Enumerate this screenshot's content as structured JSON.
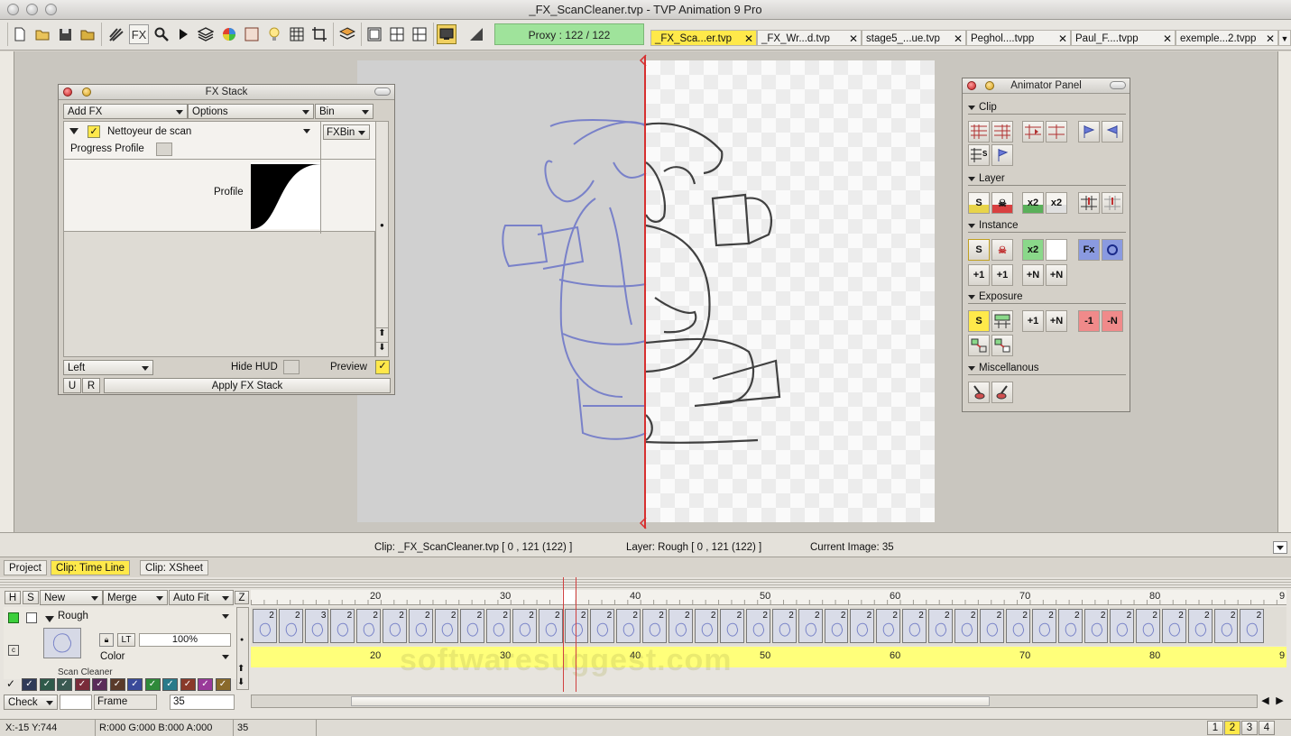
{
  "window": {
    "title": "_FX_ScanCleaner.tvp - TVP Animation 9 Pro"
  },
  "toolbar": {
    "proxy": "Proxy : 122 / 122",
    "fx_label": "FX",
    "doc_tabs": [
      "_FX_Sca...er.tvp",
      "_FX_Wr...d.tvp",
      "stage5_...ue.tvp",
      "Peghol....tvpp",
      "Paul_F....tvpp",
      "exemple...2.tvpp"
    ],
    "close_glyph": "✕",
    "tab_menu": "▼"
  },
  "fx_stack": {
    "title": "FX Stack",
    "add_fx": "Add FX",
    "options": "Options",
    "bin": "Bin",
    "effect_name": "Nettoyeur de scan",
    "fxbin": "FXBin",
    "progress_profile": "Progress Profile",
    "profile": "Profile",
    "left": "Left",
    "hide_hud": "Hide HUD",
    "preview": "Preview",
    "check_glyph": "✓",
    "u": "U",
    "r": "R",
    "apply": "Apply FX Stack"
  },
  "animator_panel": {
    "title": "Animator Panel",
    "sections": {
      "clip": "Clip",
      "layer": "Layer",
      "instance": "Instance",
      "exposure": "Exposure",
      "misc": "Miscellanous"
    },
    "layer_icons": [
      "S",
      "☠",
      "x2",
      "x2"
    ],
    "instance_icons": [
      "S",
      "☠",
      "x2",
      "Fx"
    ],
    "instance_row2": [
      "+1",
      "+1",
      "+N",
      "+N"
    ],
    "exposure_icons": [
      "S",
      "+1",
      "+N",
      "-1",
      "-N"
    ]
  },
  "status": {
    "clip": "Clip: _FX_ScanCleaner.tvp [ 0 , 121  (122) ]",
    "layer": "Layer: Rough [ 0 , 121  (122) ]",
    "current_image": "Current Image: 35"
  },
  "tabs": {
    "project": "Project",
    "timeline": "Clip: Time Line",
    "xsheet": "Clip: XSheet"
  },
  "timeline": {
    "h": "H",
    "s": "S",
    "z": "Z",
    "new": "New",
    "merge": "Merge",
    "auto_fit": "Auto Fit",
    "layer_name": "Rough",
    "lt": "LT",
    "opacity": "100%",
    "color": "Color",
    "next_layer": "Scan Cleaner",
    "check": "Check",
    "frame": "Frame",
    "frame_value": "35",
    "ruler": [
      "20",
      "30",
      "40",
      "50",
      "60",
      "70",
      "80",
      "9"
    ],
    "c_marker": "c",
    "cell_numbers": [
      "2",
      "2",
      "3",
      "2",
      "2",
      "2",
      "2",
      "2",
      "2",
      "2",
      "2",
      "2",
      "2",
      "2",
      "2",
      "2",
      "2",
      "2",
      "2",
      "2",
      "2",
      "2",
      "2",
      "2",
      "2",
      "2",
      "2",
      "2",
      "2",
      "2",
      "2",
      "2",
      "2",
      "2",
      "2",
      "2",
      "2",
      "2",
      "2"
    ],
    "swatches": [
      "#2f3a58",
      "#2f5a4a",
      "#3a5a52",
      "#7a2c3a",
      "#5a2c5a",
      "#5a3a2a",
      "#3a4a9a",
      "#2f8a3a",
      "#2a7a8a",
      "#8a3a2a",
      "#9a3a9a",
      "#8a6a2a"
    ]
  },
  "bottom": {
    "coords": "X:-15  Y:744",
    "rgba": "R:000 G:000 B:000 A:000",
    "value": "35",
    "pages": [
      "1",
      "2",
      "3",
      "4"
    ]
  },
  "watermark": "softwaresuggest.com"
}
